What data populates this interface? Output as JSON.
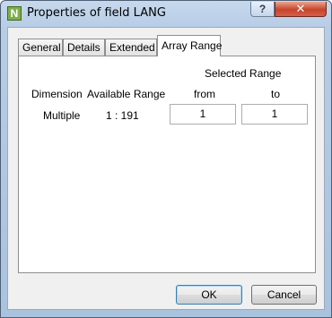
{
  "window": {
    "title": "Properties of field LANG",
    "app_icon_letter": "N",
    "help_glyph": "?",
    "close_glyph": "✕"
  },
  "tabs": [
    {
      "label": "General"
    },
    {
      "label": "Details"
    },
    {
      "label": "Extended"
    },
    {
      "label": "Array Range",
      "active": true
    }
  ],
  "array_range": {
    "selected_range_heading": "Selected Range",
    "dimension_header": "Dimension",
    "available_range_header": "Available Range",
    "from_header": "from",
    "to_header": "to",
    "dimension_value": "Multiple",
    "available_range_value": "1 : 191",
    "from_value": "1",
    "to_value": "1"
  },
  "buttons": {
    "ok": "OK",
    "cancel": "Cancel"
  }
}
